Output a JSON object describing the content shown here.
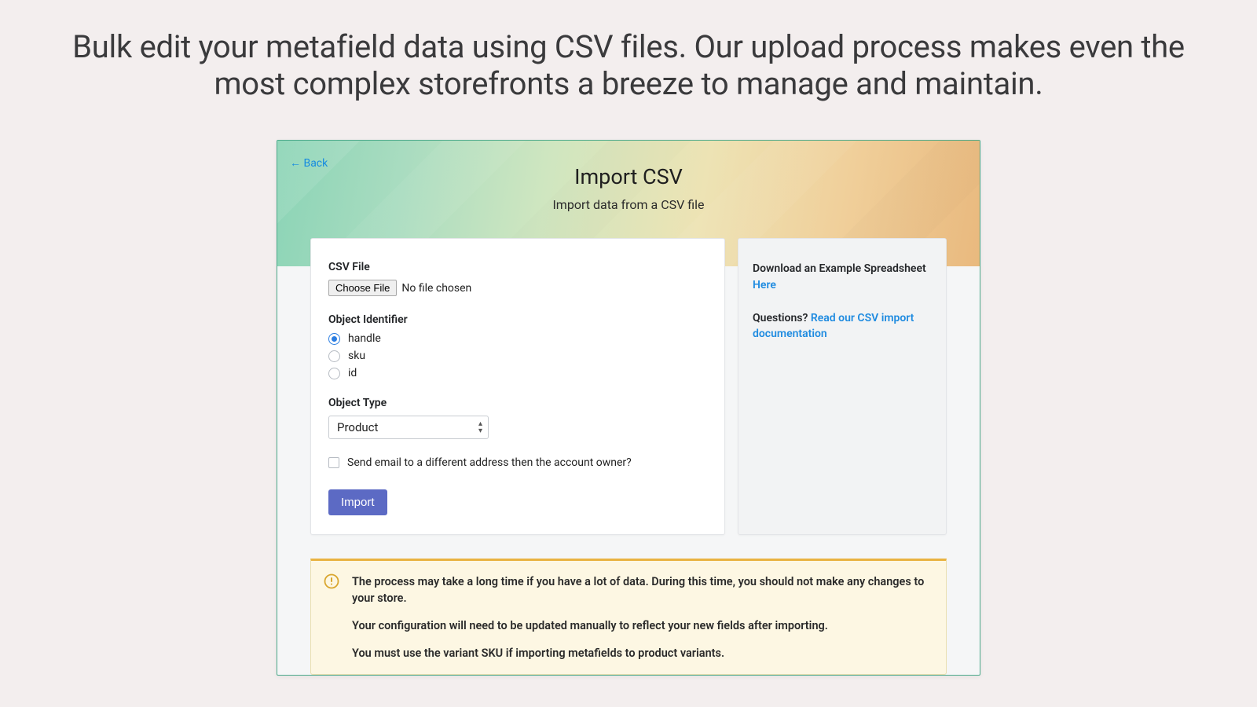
{
  "headline": "Bulk edit your metafield data using CSV files. Our upload process makes even the most complex storefronts a breeze to manage and maintain.",
  "hero": {
    "back_label": "← Back",
    "title": "Import CSV",
    "subtitle": "Import data from a CSV file"
  },
  "form": {
    "csv_file_label": "CSV File",
    "choose_file_button": "Choose File",
    "file_status": "No file chosen",
    "object_identifier_label": "Object Identifier",
    "identifier_options": [
      {
        "label": "handle",
        "checked": true
      },
      {
        "label": "sku",
        "checked": false
      },
      {
        "label": "id",
        "checked": false
      }
    ],
    "object_type_label": "Object Type",
    "object_type_value": "Product",
    "email_checkbox_label": "Send email to a different address then the account owner?",
    "import_button": "Import"
  },
  "sidebar": {
    "example_text": "Download an Example Spreadsheet ",
    "example_link": "Here",
    "questions_text": "Questions? ",
    "questions_link": "Read our CSV import documentation"
  },
  "warning": {
    "line1": "The process may take a long time if you have a lot of data. During this time, you should not make any changes to your store.",
    "line2": "Your configuration will need to be updated manually to reflect your new fields after importing.",
    "line3": "You must use the variant SKU if importing metafields to product variants."
  }
}
